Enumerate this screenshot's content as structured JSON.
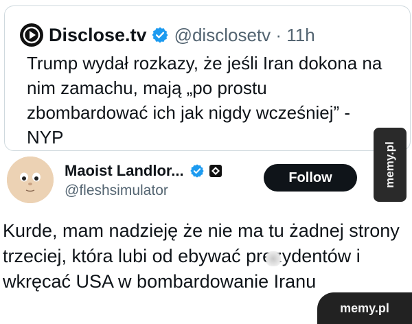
{
  "quoted_tweet": {
    "logo_icon": "play-logo-icon",
    "name": "Disclose.tv",
    "verified_icon": "verified-badge-icon",
    "handle_time": "@disclosetv · 11h",
    "text": "Trump wydał rozkazy, że jeśli Iran dokona na nim zamachu, mają „po prostu zbombardować ich jak nigdy wcześniej” - NYP"
  },
  "tweet": {
    "avatar_icon": "cartoon-face-avatar",
    "author_name": "Maoist Landlor...",
    "verified_icon": "verified-badge-icon",
    "affiliate_icon": "affiliate-badge-icon",
    "handle": "@fleshsimulator",
    "follow_label": "Follow",
    "text": "Kurde, mam nadzieję że nie ma tu żadnej strony trzeciej, która lubi od  ebywać prezydentów i wkręcać USA w bombardowanie Iranu"
  },
  "watermarks": {
    "side": "memy.pl",
    "corner": "memy.pl"
  },
  "colors": {
    "verified_blue": "#1d9bf0",
    "text": "#0f1419",
    "secondary": "#536471",
    "follow_bg": "#0f1419"
  }
}
